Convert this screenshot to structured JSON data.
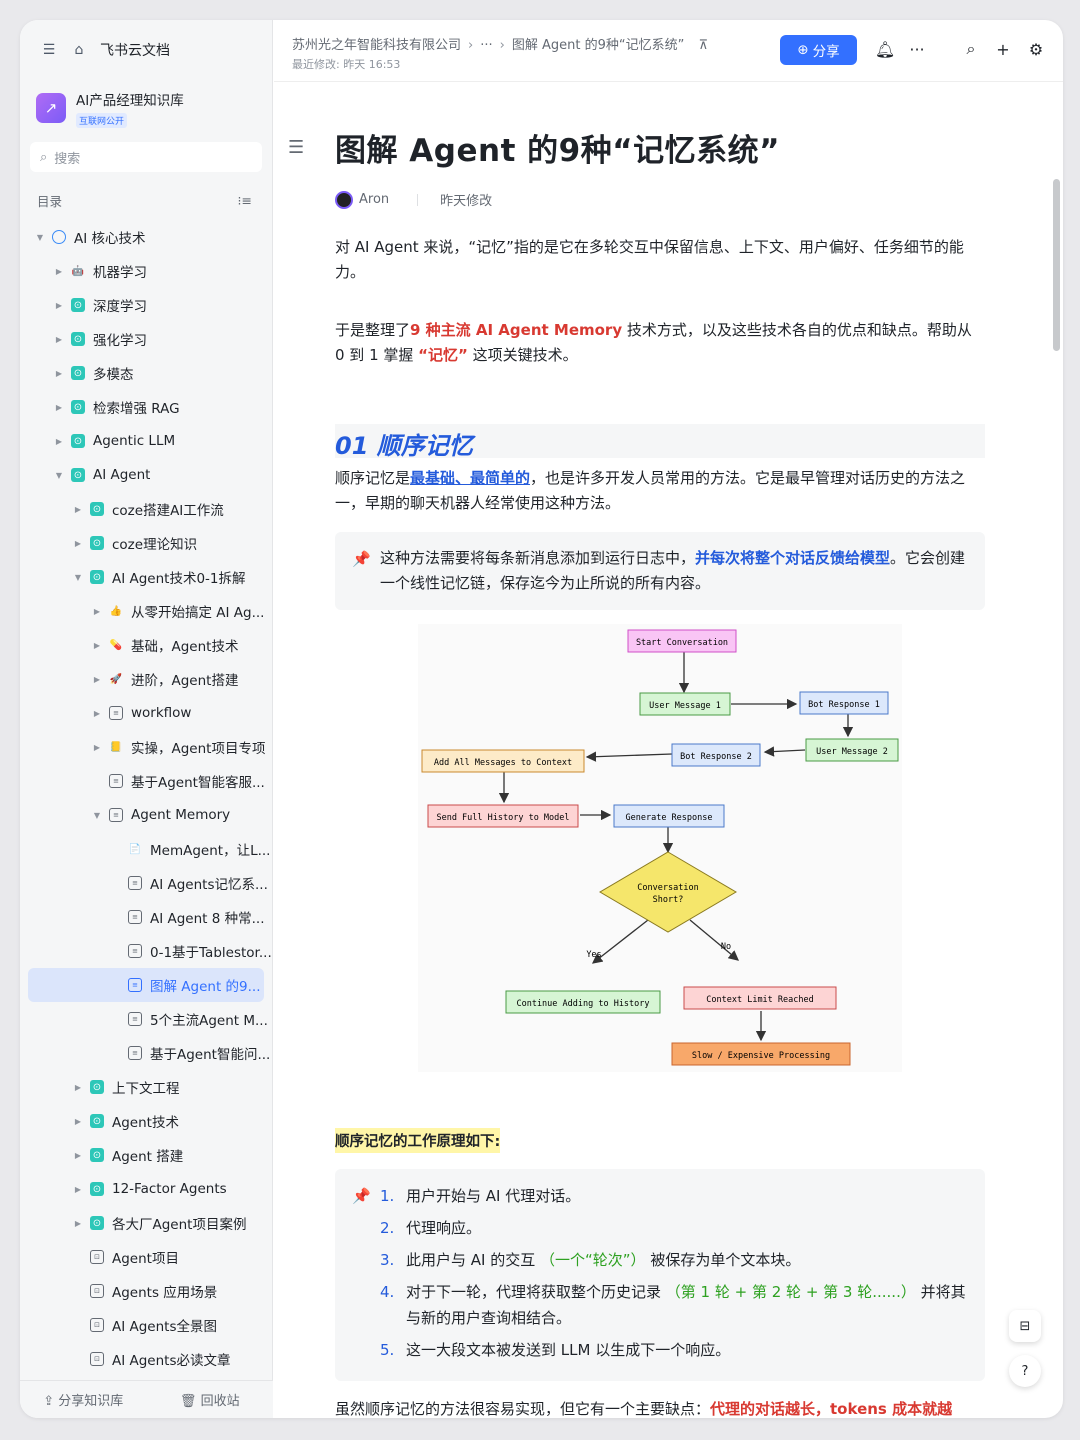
{
  "app": {
    "name": "飞书云文档"
  },
  "kb": {
    "title": "AI产品经理知识库",
    "badge": "互联网公开"
  },
  "search": {
    "placeholder": "搜索"
  },
  "toc": {
    "title": "目录"
  },
  "tree": [
    {
      "label": "AI 核心技术",
      "level": 0,
      "arrow": "down",
      "icon": "globe"
    },
    {
      "label": "机器学习",
      "level": 1,
      "arrow": "right",
      "icon": "robot"
    },
    {
      "label": "深度学习",
      "level": 1,
      "arrow": "right",
      "icon": "teal"
    },
    {
      "label": "强化学习",
      "level": 1,
      "arrow": "right",
      "icon": "teal"
    },
    {
      "label": "多模态",
      "level": 1,
      "arrow": "right",
      "icon": "teal"
    },
    {
      "label": "检索增强 RAG",
      "level": 1,
      "arrow": "right",
      "icon": "teal"
    },
    {
      "label": "Agentic LLM",
      "level": 1,
      "arrow": "right",
      "icon": "teal"
    },
    {
      "label": "AI Agent",
      "level": 1,
      "arrow": "down",
      "icon": "teal"
    },
    {
      "label": "coze搭建AI工作流",
      "level": 2,
      "arrow": "right",
      "icon": "teal"
    },
    {
      "label": "coze理论知识",
      "level": 2,
      "arrow": "right",
      "icon": "teal"
    },
    {
      "label": "AI Agent技术0-1拆解",
      "level": 2,
      "arrow": "down",
      "icon": "teal"
    },
    {
      "label": "从零开始搞定 AI Ag...",
      "level": 3,
      "arrow": "right",
      "icon": "hand"
    },
    {
      "label": "基础，Agent技术",
      "level": 3,
      "arrow": "right",
      "icon": "pill"
    },
    {
      "label": "进阶，Agent搭建",
      "level": 3,
      "arrow": "right",
      "icon": "rocket"
    },
    {
      "label": "workflow",
      "level": 3,
      "arrow": "right",
      "icon": "doc"
    },
    {
      "label": "实操，Agent项目专项",
      "level": 3,
      "arrow": "right",
      "icon": "folder"
    },
    {
      "label": "基于Agent智能客服...",
      "level": 3,
      "arrow": "",
      "icon": "doc"
    },
    {
      "label": "Agent Memory",
      "level": 3,
      "arrow": "down",
      "icon": "doc"
    },
    {
      "label": "MemAgent，让L...",
      "level": 4,
      "arrow": "",
      "icon": "page"
    },
    {
      "label": "AI Agents记忆系...",
      "level": 4,
      "arrow": "",
      "icon": "doc"
    },
    {
      "label": "AI Agent 8 种常...",
      "level": 4,
      "arrow": "",
      "icon": "doc"
    },
    {
      "label": "0-1基于Tablestor...",
      "level": 4,
      "arrow": "",
      "icon": "doc"
    },
    {
      "label": "图解 Agent 的9...",
      "level": 4,
      "arrow": "",
      "icon": "doc-blue",
      "selected": true
    },
    {
      "label": "5个主流Agent M...",
      "level": 4,
      "arrow": "",
      "icon": "doc"
    },
    {
      "label": "基于Agent智能问...",
      "level": 4,
      "arrow": "",
      "icon": "doc"
    },
    {
      "label": "上下文工程",
      "level": 2,
      "arrow": "right",
      "icon": "teal"
    },
    {
      "label": "Agent技术",
      "level": 2,
      "arrow": "right",
      "icon": "teal"
    },
    {
      "label": "Agent 搭建",
      "level": 2,
      "arrow": "right",
      "icon": "teal"
    },
    {
      "label": "12-Factor Agents",
      "level": 2,
      "arrow": "right",
      "icon": "teal"
    },
    {
      "label": "各大厂Agent项目案例",
      "level": 2,
      "arrow": "right",
      "icon": "teal"
    },
    {
      "label": "Agent项目",
      "level": 2,
      "arrow": "",
      "icon": "box"
    },
    {
      "label": "Agents 应用场景",
      "level": 2,
      "arrow": "",
      "icon": "box"
    },
    {
      "label": "AI Agents全景图",
      "level": 2,
      "arrow": "",
      "icon": "box"
    },
    {
      "label": "AI Agents必读文章",
      "level": 2,
      "arrow": "",
      "icon": "box"
    }
  ],
  "sidebar_bottom": {
    "share": "分享知识库",
    "trash": "回收站"
  },
  "header": {
    "crumb_company": "苏州光之年智能科技有限公司",
    "crumb_more": "···",
    "crumb_current": "图解 Agent 的9种“记忆系统”",
    "modified": "最近修改: 昨天 16:53",
    "share_label": "分享"
  },
  "doc": {
    "title": "图解 Agent 的9种“记忆系统”",
    "author": "Aron",
    "edited": "昨天修改",
    "p1": "对 AI Agent 来说，“记忆”指的是它在多轮交互中保留信息、上下文、用户偏好、任务细节的能力。",
    "p2_a": "于是整理了",
    "p2_b": "9 种主流 AI Agent Memory",
    "p2_c": " 技术方式，以及这些技术各自的优点和缺点。帮助从 0 到 1 掌握 ",
    "p2_d": "“记忆”",
    "p2_e": " 这项关键技术。",
    "h1": "01 顺序记忆",
    "p3_a": "顺序记忆是",
    "p3_b": "最基础、最简单的",
    "p3_c": "，也是许多开发人员常用的方法。它是最早管理对话历史的方法之一，早期的聊天机器人经常使用这种方法。",
    "callout_a": "这种方法需要将每条新消息添加到运行日志中，",
    "callout_b": "并每次将整个对话反馈给模型",
    "callout_c": "。它会创建一个线性记忆链，保存迄今为止所说的所有内容。",
    "highlight": "顺序记忆的工作原理如下:",
    "steps": [
      {
        "n": "1.",
        "a": "用户开始与 AI 代理对话。",
        "g": "",
        "b": ""
      },
      {
        "n": "2.",
        "a": "代理响应。",
        "g": "",
        "b": ""
      },
      {
        "n": "3.",
        "a": "此用户与 AI 的交互 ",
        "g": "（一个“轮次”）",
        "b": " 被保存为单个文本块。"
      },
      {
        "n": "4.",
        "a": "对于下一轮，代理将获取整个历史记录 ",
        "g": "（第 1 轮 + 第 2 轮 + 第 3 轮......）",
        "b": " 并将其与新的用户查询相结合。"
      },
      {
        "n": "5.",
        "a": "这一大段文本被发送到 LLM 以生成下一个响应。",
        "g": "",
        "b": ""
      }
    ],
    "last_a": "虽然顺序记忆的方法很容易实现，但它有一个主要缺点：",
    "last_b": "代理的对话越长，tokens 成本就越"
  },
  "flow": {
    "start": "Start Conversation",
    "um1": "User Message 1",
    "br1": "Bot Response 1",
    "um2": "User Message 2",
    "br2": "Bot Response 2",
    "add": "Add All Messages to Context",
    "send": "Send Full History to Model",
    "gen": "Generate Response",
    "cond1": "Conversation",
    "cond2": "Short?",
    "yes": "Yes",
    "no": "No",
    "cont": "Continue Adding to History",
    "limit": "Context Limit Reached",
    "slow": "Slow / Expensive Processing"
  },
  "colors": {
    "accent": "#3370ff",
    "title_blue": "#245bdb",
    "red": "#d83931",
    "green": "#2ea121",
    "highlight": "#fff6a8"
  }
}
